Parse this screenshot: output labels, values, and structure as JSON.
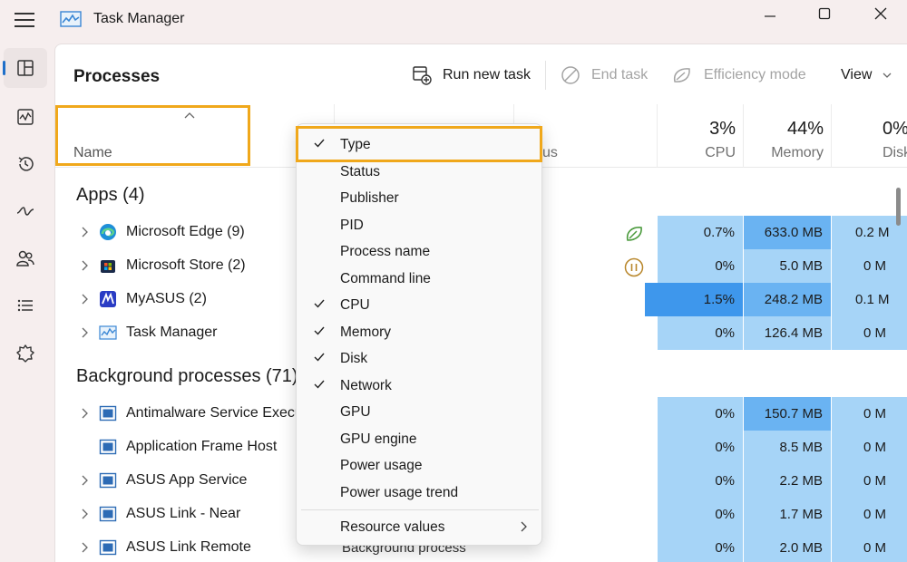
{
  "window": {
    "title": "Task Manager",
    "logo_icon": "task-manager-chart-icon"
  },
  "nav": [
    {
      "icon": "processes-icon",
      "active": true
    },
    {
      "icon": "performance-icon",
      "active": false
    },
    {
      "icon": "app-history-icon",
      "active": false
    },
    {
      "icon": "startup-apps-icon",
      "active": false
    },
    {
      "icon": "users-icon",
      "active": false
    },
    {
      "icon": "details-icon",
      "active": false
    },
    {
      "icon": "services-icon",
      "active": false
    }
  ],
  "page": {
    "title": "Processes"
  },
  "toolbar": {
    "run_new_task": "Run new task",
    "end_task": "End task",
    "efficiency_mode": "Efficiency mode",
    "view": "View"
  },
  "columns": {
    "name": "Name",
    "status_partial": "us",
    "cpu_pct": "3%",
    "cpu_label": "CPU",
    "memory_pct": "44%",
    "memory_label": "Memory",
    "disk_pct": "0%",
    "disk_label": "Disk"
  },
  "sections": {
    "apps": "Apps (4)",
    "background": "Background processes (71)"
  },
  "apps": [
    {
      "name": "Microsoft Edge (9)",
      "status_icon": "efficiency-leaf-icon",
      "cpu": "0.7%",
      "memory": "633.0 MB",
      "disk": "0.2 M"
    },
    {
      "name": "Microsoft Store (2)",
      "status_icon": "suspended-pause-icon",
      "cpu": "0%",
      "memory": "5.0 MB",
      "disk": "0 M"
    },
    {
      "name": "MyASUS (2)",
      "status_icon": "",
      "cpu": "1.5%",
      "memory": "248.2 MB",
      "disk": "0.1 M"
    },
    {
      "name": "Task Manager",
      "status_icon": "",
      "cpu": "0%",
      "memory": "126.4 MB",
      "disk": "0 M"
    }
  ],
  "background": [
    {
      "name": "Antimalware Service Execu",
      "expandable": true,
      "cpu": "0%",
      "memory": "150.7 MB",
      "disk": "0 M"
    },
    {
      "name": "Application Frame Host",
      "expandable": false,
      "cpu": "0%",
      "memory": "8.5 MB",
      "disk": "0 M"
    },
    {
      "name": "ASUS App Service",
      "expandable": true,
      "cpu": "0%",
      "memory": "2.2 MB",
      "disk": "0 M"
    },
    {
      "name": "ASUS Link - Near",
      "expandable": true,
      "cpu": "0%",
      "memory": "1.7 MB",
      "disk": "0 M"
    },
    {
      "name": "ASUS Link Remote",
      "expandable": true,
      "cpu": "0%",
      "memory": "2.0 MB",
      "disk": "0 M"
    }
  ],
  "peek_text": "Background process",
  "context_menu": {
    "items": [
      {
        "label": "Type",
        "checked": true
      },
      {
        "label": "Status",
        "checked": false
      },
      {
        "label": "Publisher",
        "checked": false
      },
      {
        "label": "PID",
        "checked": false
      },
      {
        "label": "Process name",
        "checked": false
      },
      {
        "label": "Command line",
        "checked": false
      },
      {
        "label": "CPU",
        "checked": true
      },
      {
        "label": "Memory",
        "checked": true
      },
      {
        "label": "Disk",
        "checked": true
      },
      {
        "label": "Network",
        "checked": true
      },
      {
        "label": "GPU",
        "checked": false
      },
      {
        "label": "GPU engine",
        "checked": false
      },
      {
        "label": "Power usage",
        "checked": false
      },
      {
        "label": "Power usage trend",
        "checked": false
      }
    ],
    "submenu_label": "Resource values"
  },
  "colors": {
    "accent": "#1e6fc9",
    "highlight_box": "#f0a81b",
    "heat_light": "#a6d4f7",
    "heat_medium": "#6ab3f2",
    "heat_strong": "#3e97ec"
  }
}
